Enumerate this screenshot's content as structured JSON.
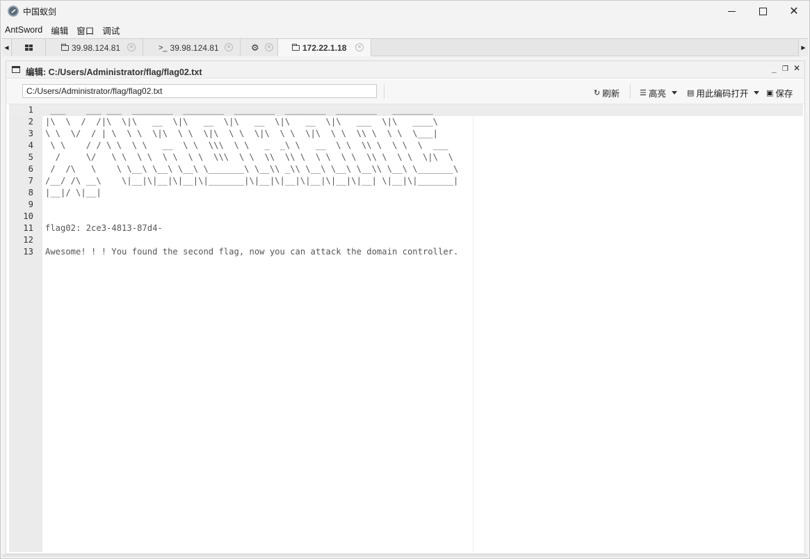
{
  "window": {
    "title": "中国蚁剑",
    "controls": {
      "minimize": "minimize",
      "maximize": "maximize",
      "close": "✕"
    }
  },
  "menubar": [
    "AntSword",
    "编辑",
    "窗口",
    "调试"
  ],
  "tabs": [
    {
      "icon": "grid-icon",
      "label": ""
    },
    {
      "icon": "folder-icon",
      "label": "39.98.124.81"
    },
    {
      "icon": "terminal-icon",
      "label": "39.98.124.81",
      "prefix": ">_"
    },
    {
      "icon": "gear-icon",
      "label": ""
    },
    {
      "icon": "folder-icon",
      "label": "172.22.1.18",
      "active": true
    }
  ],
  "panel": {
    "title": "编辑: C:/Users/Administrator/flag/flag02.txt",
    "path_value": "C:/Users/Administrator/flag/flag02.txt",
    "toolbar": {
      "refresh": "刷新",
      "highlight": "高亮",
      "open_encoding": "用此编码打开",
      "save": "保存"
    }
  },
  "editor": {
    "lines": [
      {
        "n": "1",
        "text": " ___    ___ ___  ________  ________  ________  ________  ________   ________"
      },
      {
        "n": "2",
        "text": "|\\  \\  /  /|\\  \\|\\   __  \\|\\   __  \\|\\   __  \\|\\   __  \\|\\   ___  \\|\\   ____\\"
      },
      {
        "n": "3",
        "text": "\\ \\  \\/  / | \\  \\ \\  \\|\\  \\ \\  \\|\\  \\ \\  \\|\\  \\ \\  \\|\\  \\ \\  \\\\ \\  \\ \\  \\___|"
      },
      {
        "n": "4",
        "text": " \\ \\    / / \\ \\  \\ \\   __  \\ \\  \\\\\\  \\ \\   _  _\\ \\   __  \\ \\  \\\\ \\  \\ \\  \\  ___"
      },
      {
        "n": "5",
        "text": "  /     \\/   \\ \\  \\ \\  \\ \\  \\ \\  \\\\\\  \\ \\  \\\\  \\\\ \\  \\ \\  \\ \\  \\\\ \\  \\ \\  \\|\\  \\"
      },
      {
        "n": "6",
        "text": " /  /\\   \\    \\ \\__\\ \\__\\ \\__\\ \\_______\\ \\__\\\\ _\\\\ \\__\\ \\__\\ \\__\\\\ \\__\\ \\_______\\"
      },
      {
        "n": "7",
        "text": "/__/ /\\ __\\    \\|__|\\|__|\\|__|\\|_______|\\|__|\\|__|\\|__|\\|__|\\|__| \\|__|\\|_______|"
      },
      {
        "n": "8",
        "text": "|__|/ \\|__|"
      },
      {
        "n": "9",
        "text": ""
      },
      {
        "n": "10",
        "text": ""
      },
      {
        "n": "11",
        "text": "flag02: 2ce3-4813-87d4-"
      },
      {
        "n": "12",
        "text": ""
      },
      {
        "n": "13",
        "text": "Awesome! ! ! You found the second flag, now you can attack the domain controller."
      }
    ]
  }
}
